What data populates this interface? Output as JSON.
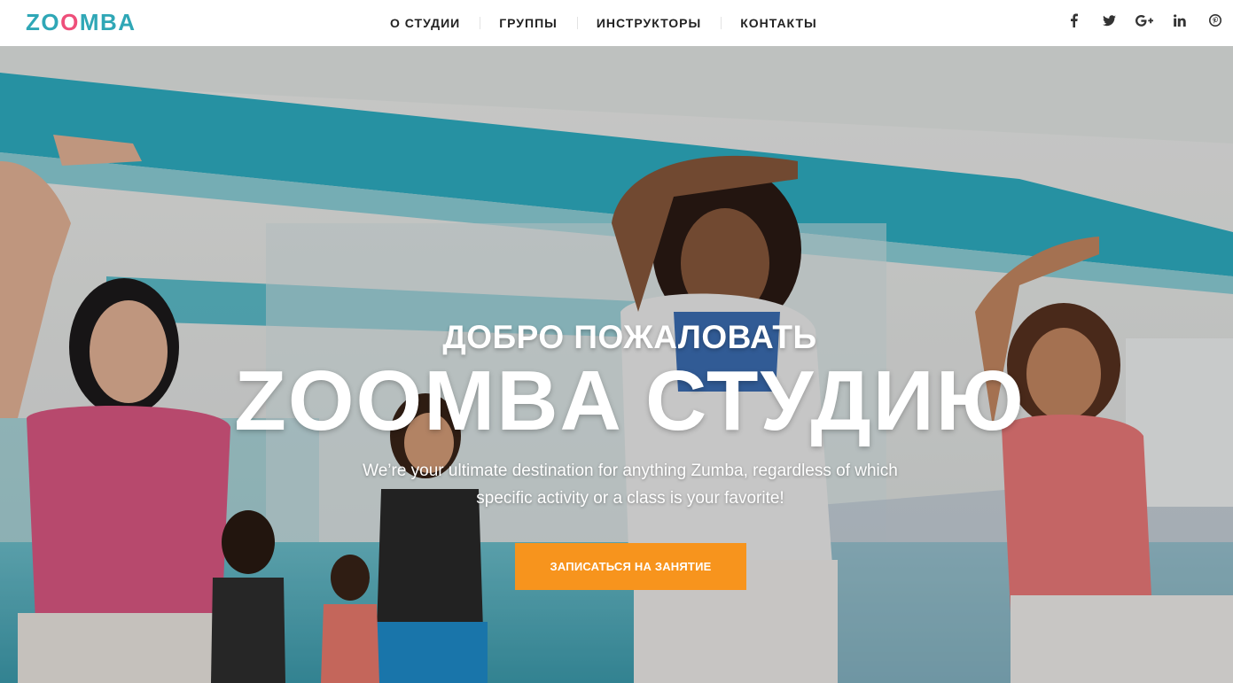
{
  "header": {
    "logo": {
      "parts": [
        "ZO",
        "O",
        "MBA"
      ]
    },
    "nav": [
      {
        "label": "О СТУДИИ"
      },
      {
        "label": "ГРУППЫ"
      },
      {
        "label": "ИНСТРУКТОРЫ"
      },
      {
        "label": "КОНТАКТЫ"
      }
    ],
    "social": [
      "facebook-icon",
      "twitter-icon",
      "google-plus-icon",
      "linkedin-icon",
      "pinterest-icon"
    ]
  },
  "hero": {
    "kicker": "ДОБРО ПОЖАЛОВАТЬ",
    "title": "ZOOMBA СТУДИЮ",
    "text": "We’re your ultimate destination for anything Zumba, regardless of which specific activity or a class is your favorite!",
    "button_label": "ЗАПИСАТЬСЯ НА ЗАНЯТИЕ"
  },
  "colors": {
    "brand_teal": "#2fa7b6",
    "brand_pink": "#ee4f7a",
    "accent_orange": "#f7941d",
    "nav_text": "#222222"
  }
}
